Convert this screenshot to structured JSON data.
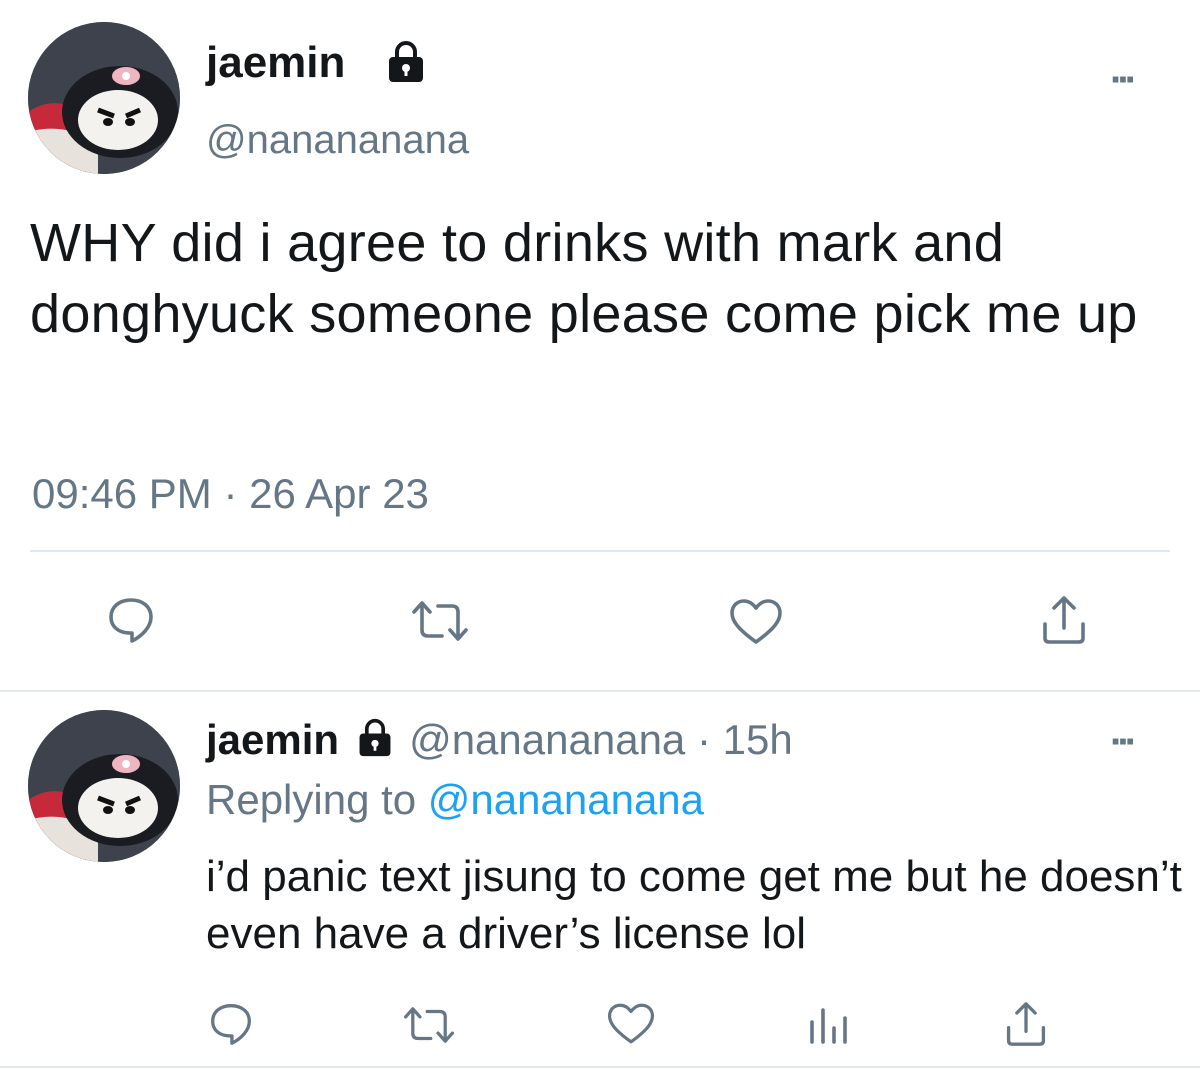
{
  "main_tweet": {
    "display_name": "jaemin",
    "handle": "@nanananana",
    "text": "WHY did i agree to drinks with mark and donghyuck someone please come pick me up",
    "timestamp": "09:46 PM · 26 Apr 23",
    "more_label": "···",
    "actions": [
      "reply-icon",
      "retweet-icon",
      "like-icon",
      "share-icon"
    ]
  },
  "reply_tweet": {
    "display_name": "jaemin",
    "handle_time": "@nanananana · 15h",
    "replying_prefix": "Replying to",
    "replying_handle": "@nanananana",
    "text": "i’d panic text jisung to come get me but he doesn’t even have a driver’s license lol",
    "more_label": "···",
    "actions": [
      "reply-icon",
      "retweet-icon",
      "like-icon",
      "analytics-icon",
      "share-icon"
    ]
  },
  "colors": {
    "text": "#14171a",
    "secondary": "#657786",
    "link": "#1da1f2",
    "divider": "#e1e8ed"
  }
}
